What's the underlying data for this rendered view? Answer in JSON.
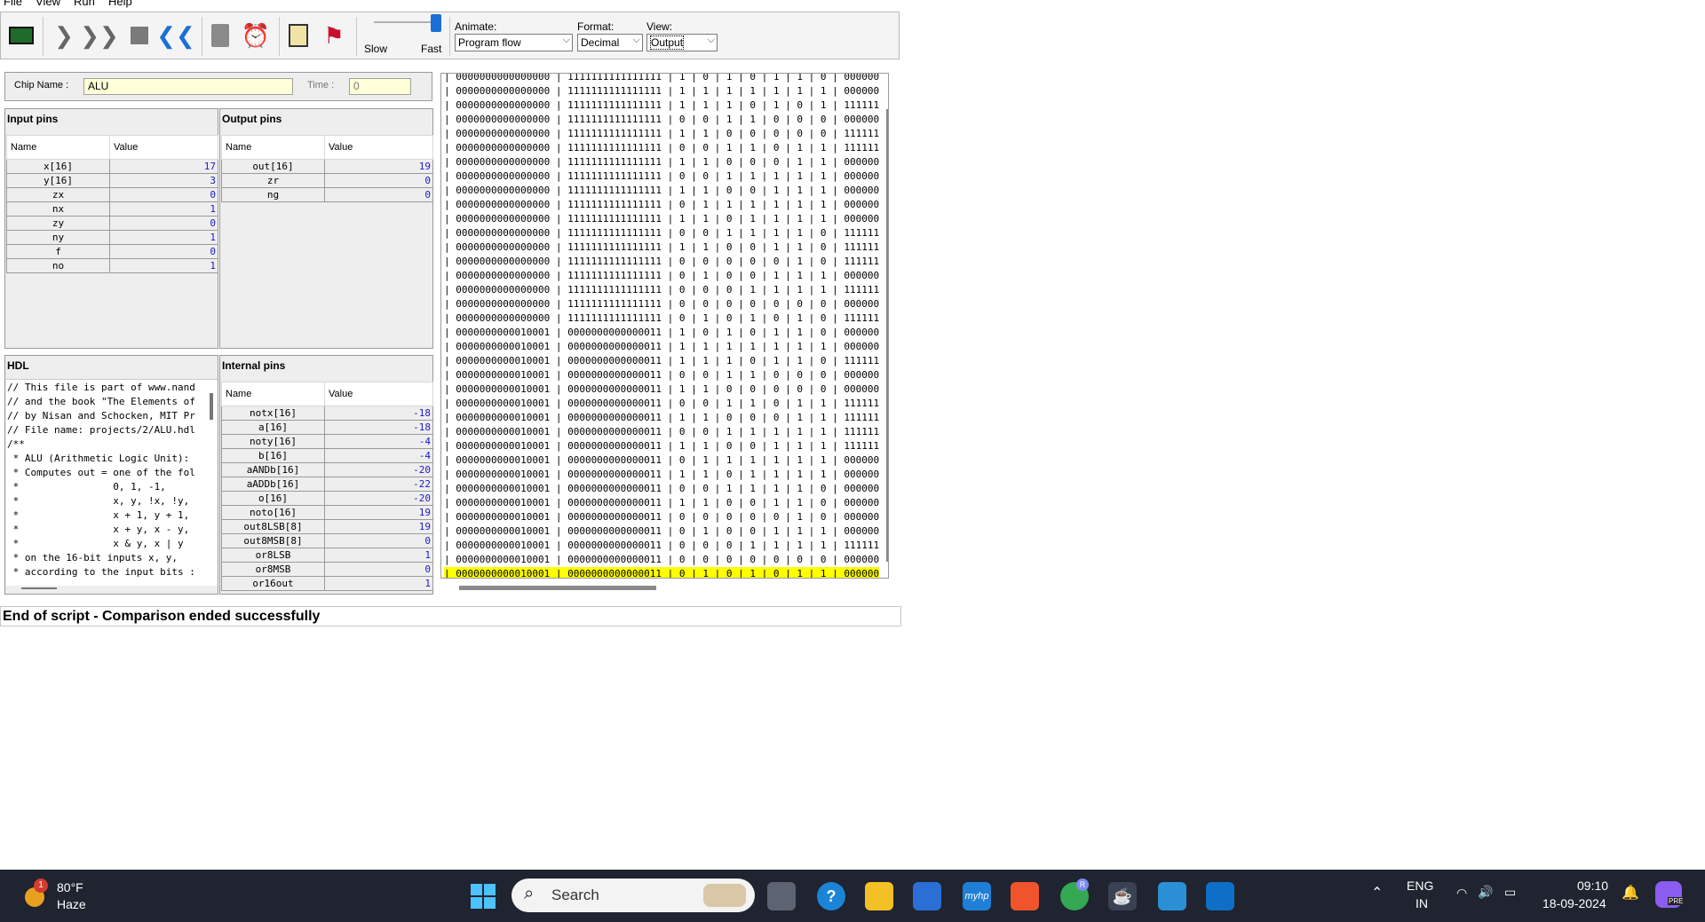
{
  "menu": [
    "File",
    "View",
    "Run",
    "Help"
  ],
  "toolbar": {
    "speed_slow_label": "Slow",
    "speed_fast_label": "Fast",
    "animate_label": "Animate:",
    "animate_value": "Program flow",
    "format_label": "Format:",
    "format_value": "Decimal",
    "view_label": "View:",
    "view_value": "Output",
    "speed_level": 1.0
  },
  "chip": {
    "name_label": "Chip Name :",
    "name_value": "ALU",
    "time_label": "Time :",
    "time_value": "0"
  },
  "input_pins": {
    "title": "Input pins",
    "col_name": "Name",
    "col_value": "Value",
    "rows": [
      {
        "name": "x[16]",
        "value": "17"
      },
      {
        "name": "y[16]",
        "value": "3"
      },
      {
        "name": "zx",
        "value": "0"
      },
      {
        "name": "nx",
        "value": "1"
      },
      {
        "name": "zy",
        "value": "0"
      },
      {
        "name": "ny",
        "value": "1"
      },
      {
        "name": "f",
        "value": "0"
      },
      {
        "name": "no",
        "value": "1"
      }
    ]
  },
  "output_pins": {
    "title": "Output pins",
    "col_name": "Name",
    "col_value": "Value",
    "rows": [
      {
        "name": "out[16]",
        "value": "19"
      },
      {
        "name": "zr",
        "value": "0"
      },
      {
        "name": "ng",
        "value": "0"
      }
    ]
  },
  "hdl": {
    "title": "HDL",
    "lines": [
      "// This file is part of www.nand",
      "// and the book \"The Elements of",
      "// by Nisan and Schocken, MIT Pr",
      "// File name: projects/2/ALU.hdl",
      "/**",
      " * ALU (Arithmetic Logic Unit):",
      " * Computes out = one of the fol",
      " *                0, 1, -1,",
      " *                x, y, !x, !y,",
      " *                x + 1, y + 1,",
      " *                x + y, x - y,",
      " *                x & y, x | y",
      " * on the 16-bit inputs x, y,",
      " * according to the input bits :"
    ]
  },
  "internal_pins": {
    "title": "Internal pins",
    "col_name": "Name",
    "col_value": "Value",
    "rows": [
      {
        "name": "notx[16]",
        "value": "-18"
      },
      {
        "name": "a[16]",
        "value": "-18"
      },
      {
        "name": "noty[16]",
        "value": "-4"
      },
      {
        "name": "b[16]",
        "value": "-4"
      },
      {
        "name": "aANDb[16]",
        "value": "-20"
      },
      {
        "name": "aADDb[16]",
        "value": "-22"
      },
      {
        "name": "o[16]",
        "value": "-20"
      },
      {
        "name": "noto[16]",
        "value": "19"
      },
      {
        "name": "out8LSB[8]",
        "value": "19"
      },
      {
        "name": "out8MSB[8]",
        "value": "0"
      },
      {
        "name": "or8LSB",
        "value": "1"
      },
      {
        "name": "or8MSB",
        "value": "0"
      },
      {
        "name": "or16out",
        "value": "1"
      }
    ]
  },
  "compare_output": {
    "rows": [
      "| 0000000000000000 | 1111111111111111 | 1 | 0 | 1 | 0 | 1 | 1 | 0 | 000000",
      "| 0000000000000000 | 1111111111111111 | 1 | 1 | 1 | 1 | 1 | 1 | 1 | 000000",
      "| 0000000000000000 | 1111111111111111 | 1 | 1 | 1 | 0 | 1 | 0 | 1 | 111111",
      "| 0000000000000000 | 1111111111111111 | 0 | 0 | 1 | 1 | 0 | 0 | 0 | 000000",
      "| 0000000000000000 | 1111111111111111 | 1 | 1 | 0 | 0 | 0 | 0 | 0 | 111111",
      "| 0000000000000000 | 1111111111111111 | 0 | 0 | 1 | 1 | 0 | 1 | 1 | 111111",
      "| 0000000000000000 | 1111111111111111 | 1 | 1 | 0 | 0 | 0 | 1 | 1 | 000000",
      "| 0000000000000000 | 1111111111111111 | 0 | 0 | 1 | 1 | 1 | 1 | 1 | 000000",
      "| 0000000000000000 | 1111111111111111 | 1 | 1 | 0 | 0 | 1 | 1 | 1 | 000000",
      "| 0000000000000000 | 1111111111111111 | 0 | 1 | 1 | 1 | 1 | 1 | 1 | 000000",
      "| 0000000000000000 | 1111111111111111 | 1 | 1 | 0 | 1 | 1 | 1 | 1 | 000000",
      "| 0000000000000000 | 1111111111111111 | 0 | 0 | 1 | 1 | 1 | 1 | 0 | 111111",
      "| 0000000000000000 | 1111111111111111 | 1 | 1 | 0 | 0 | 1 | 1 | 0 | 111111",
      "| 0000000000000000 | 1111111111111111 | 0 | 0 | 0 | 0 | 0 | 1 | 0 | 111111",
      "| 0000000000000000 | 1111111111111111 | 0 | 1 | 0 | 0 | 1 | 1 | 1 | 000000",
      "| 0000000000000000 | 1111111111111111 | 0 | 0 | 0 | 1 | 1 | 1 | 1 | 111111",
      "| 0000000000000000 | 1111111111111111 | 0 | 0 | 0 | 0 | 0 | 0 | 0 | 000000",
      "| 0000000000000000 | 1111111111111111 | 0 | 1 | 0 | 1 | 0 | 1 | 0 | 111111",
      "| 0000000000010001 | 0000000000000011 | 1 | 0 | 1 | 0 | 1 | 1 | 0 | 000000",
      "| 0000000000010001 | 0000000000000011 | 1 | 1 | 1 | 1 | 1 | 1 | 1 | 000000",
      "| 0000000000010001 | 0000000000000011 | 1 | 1 | 1 | 0 | 1 | 1 | 0 | 111111",
      "| 0000000000010001 | 0000000000000011 | 0 | 0 | 1 | 1 | 0 | 0 | 0 | 000000",
      "| 0000000000010001 | 0000000000000011 | 1 | 1 | 0 | 0 | 0 | 0 | 0 | 000000",
      "| 0000000000010001 | 0000000000000011 | 0 | 0 | 1 | 1 | 0 | 1 | 1 | 111111",
      "| 0000000000010001 | 0000000000000011 | 1 | 1 | 0 | 0 | 0 | 1 | 1 | 111111",
      "| 0000000000010001 | 0000000000000011 | 0 | 0 | 1 | 1 | 1 | 1 | 1 | 111111",
      "| 0000000000010001 | 0000000000000011 | 1 | 1 | 0 | 0 | 1 | 1 | 1 | 111111",
      "| 0000000000010001 | 0000000000000011 | 0 | 1 | 1 | 1 | 1 | 1 | 1 | 000000",
      "| 0000000000010001 | 0000000000000011 | 1 | 1 | 0 | 1 | 1 | 1 | 1 | 000000",
      "| 0000000000010001 | 0000000000000011 | 0 | 0 | 1 | 1 | 1 | 1 | 0 | 000000",
      "| 0000000000010001 | 0000000000000011 | 1 | 1 | 0 | 0 | 1 | 1 | 0 | 000000",
      "| 0000000000010001 | 0000000000000011 | 0 | 0 | 0 | 0 | 0 | 1 | 0 | 000000",
      "| 0000000000010001 | 0000000000000011 | 0 | 1 | 0 | 0 | 1 | 1 | 1 | 000000",
      "| 0000000000010001 | 0000000000000011 | 0 | 0 | 0 | 1 | 1 | 1 | 1 | 111111",
      "| 0000000000010001 | 0000000000000011 | 0 | 0 | 0 | 0 | 0 | 0 | 0 | 000000",
      "| 0000000000010001 | 0000000000000011 | 0 | 1 | 0 | 1 | 0 | 1 | 1 | 000000"
    ],
    "highlight_color": "#ffff00"
  },
  "status": "End of script - Comparison ended successfully",
  "taskbar": {
    "weather_temp": "80°F",
    "weather_desc": "Haze",
    "weather_badge": "1",
    "search_placeholder": "Search",
    "lang_line1": "ENG",
    "lang_line2": "IN",
    "time": "09:10",
    "date": "18-09-2024",
    "copilot_badge": "PRE",
    "hp_label": "myhp",
    "profile_badge": "R"
  }
}
